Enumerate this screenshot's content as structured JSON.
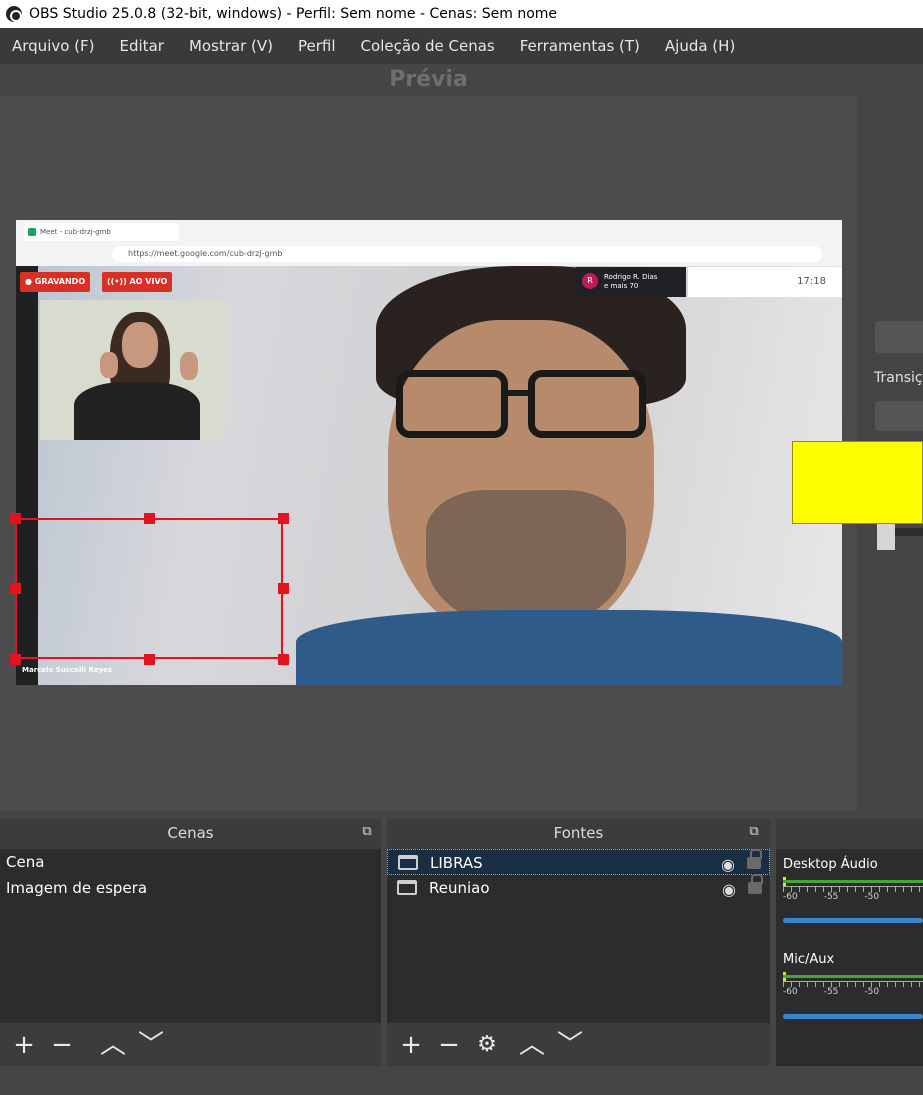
{
  "window": {
    "title": "OBS Studio 25.0.8 (32-bit, windows) - Perfil: Sem nome - Cenas: Sem nome"
  },
  "menu": [
    {
      "label": "Arquivo (F)"
    },
    {
      "label": "Editar"
    },
    {
      "label": "Mostrar (V)"
    },
    {
      "label": "Perfil"
    },
    {
      "label": "Coleção de Cenas"
    },
    {
      "label": "Ferramentas (T)"
    },
    {
      "label": "Ajuda (H)"
    }
  ],
  "preview": {
    "label": "Prévia"
  },
  "captured": {
    "tab_title": "Meet - cub-drzj-gmb",
    "url": "https://meet.google.com/cub-drzj-gmb",
    "recording_badge": "GRAVANDO",
    "live_badge": "AO VIVO",
    "participant_initial": "R",
    "participant_name": "Rodrigo R. Dias",
    "participant_extra": "e mais 70",
    "clock": "17:18",
    "name_tag": "Marcelo Succolli Reyes"
  },
  "transitions": {
    "label": "Transiç"
  },
  "scenes": {
    "title": "Cenas",
    "items": [
      {
        "label": "Cena"
      },
      {
        "label": "Imagem de espera"
      }
    ]
  },
  "sources": {
    "title": "Fontes",
    "items": [
      {
        "label": "LIBRAS"
      },
      {
        "label": "Reuniao"
      }
    ]
  },
  "mixer": {
    "channels": [
      {
        "name": "Desktop Áudio",
        "ticks": [
          "-60",
          "-55",
          "-50"
        ]
      },
      {
        "name": "Mic/Aux",
        "ticks": [
          "-60",
          "-55",
          "-50"
        ]
      }
    ]
  },
  "colors": {
    "selection_box": "#e3141e",
    "highlight_box": "#ffff00",
    "volume_slider": "#3d85c6",
    "meter_green": "#4aa13d"
  }
}
